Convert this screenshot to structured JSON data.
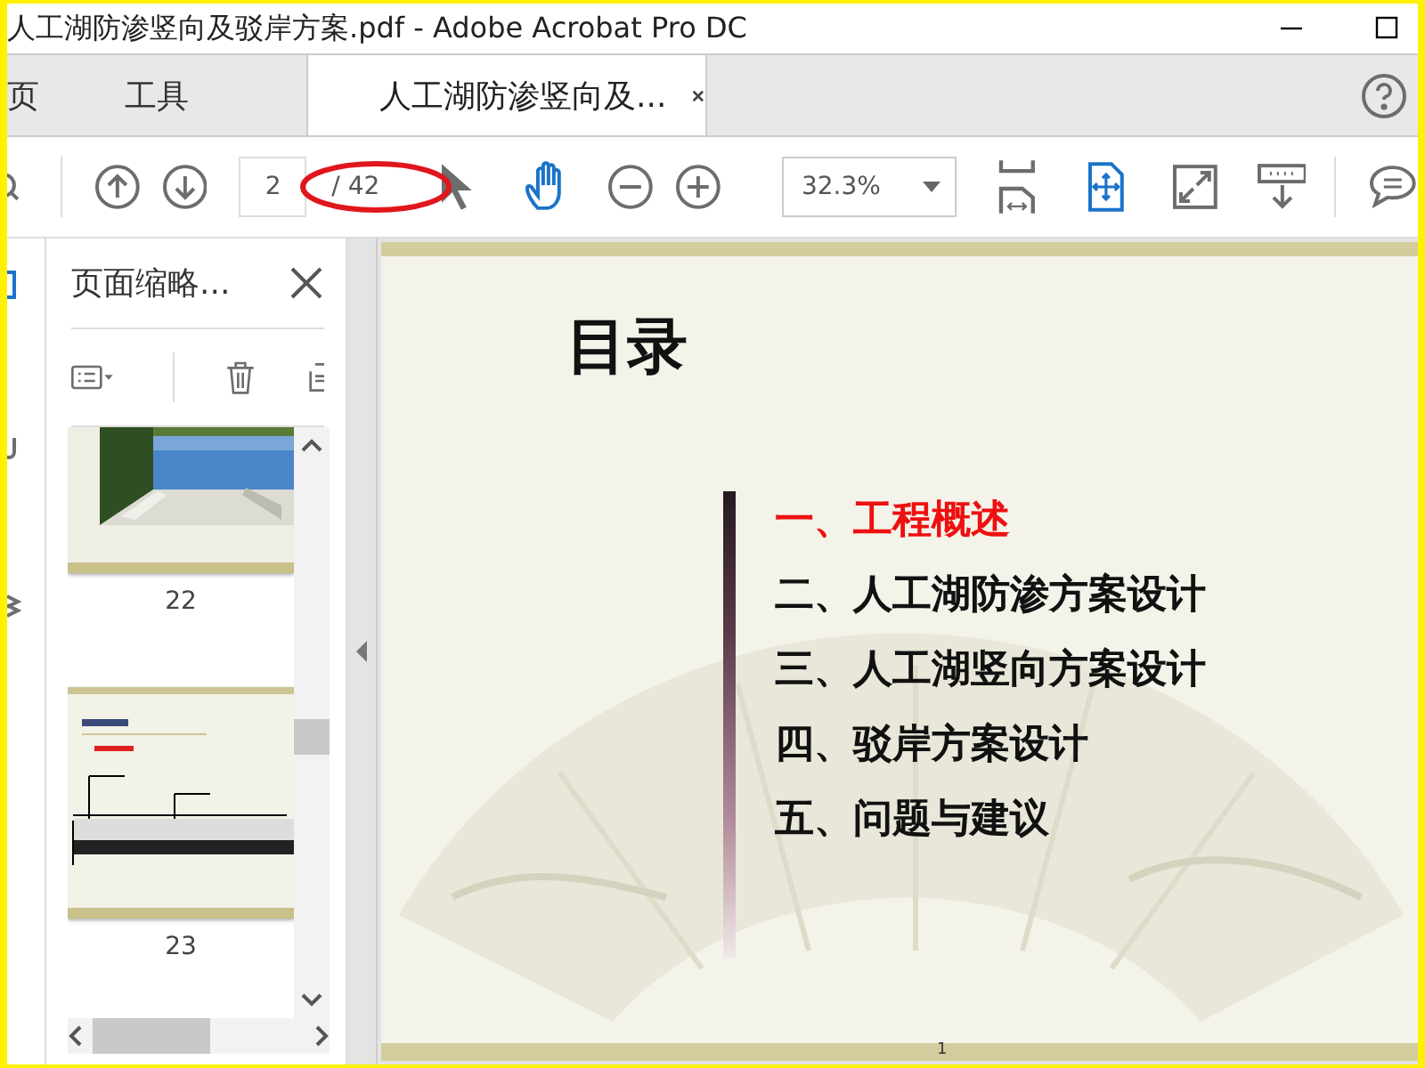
{
  "window": {
    "title": "人工湖防渗竖向及驳岸方案.pdf - Adobe Acrobat Pro DC"
  },
  "tabs": [
    {
      "label": "页",
      "selected": false,
      "kind": "nav"
    },
    {
      "label": "工具",
      "selected": false,
      "kind": "nav"
    },
    {
      "label": "人工湖防渗竖向及...",
      "selected": true,
      "kind": "document"
    }
  ],
  "toolbar": {
    "page_value": "2",
    "page_total": "/ 42",
    "zoom": "32.3%"
  },
  "thumbnail_panel": {
    "title": "页面缩略...",
    "thumbnails": [
      {
        "label": "22",
        "kind": "picture"
      },
      {
        "label": "23",
        "kind": "diagram"
      }
    ]
  },
  "slide": {
    "title": "目录",
    "items": [
      {
        "text": "一、工程概述",
        "highlighted": true
      },
      {
        "text": "二、人工湖防渗方案设计",
        "highlighted": false
      },
      {
        "text": "三、人工湖竖向方案设计",
        "highlighted": false
      },
      {
        "text": "四、驳岸方案设计",
        "highlighted": false
      },
      {
        "text": "五、问题与建议",
        "highlighted": false
      }
    ],
    "page_number": "1"
  }
}
